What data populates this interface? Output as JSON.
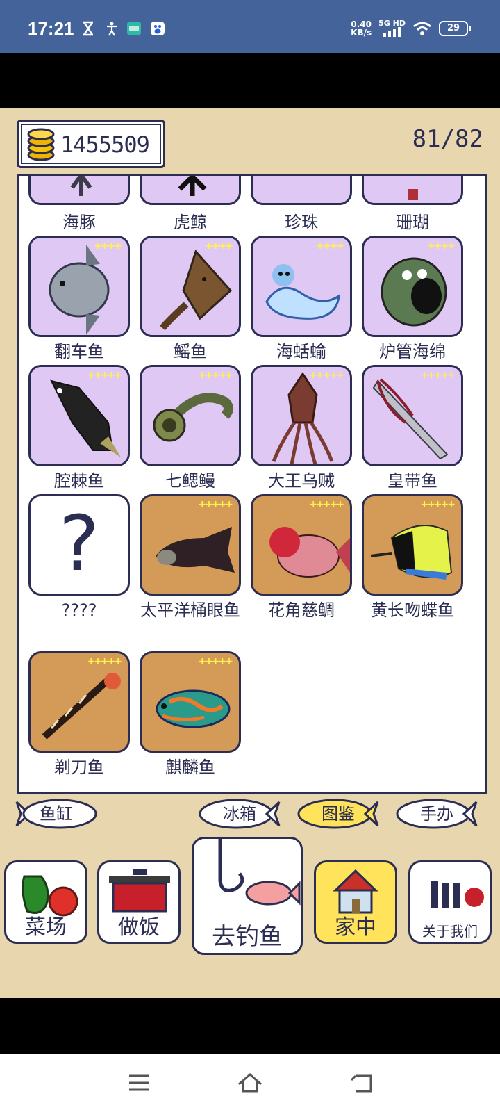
{
  "status_bar": {
    "time": "17:21",
    "net_speed_value": "0.40",
    "net_speed_unit": "KB/s",
    "network_label": "5G HD",
    "battery": "29"
  },
  "header": {
    "coins": "1455509",
    "collection_progress": "81/82"
  },
  "top_row_partial": [
    "海豚",
    "虎鲸",
    "珍珠",
    "珊瑚"
  ],
  "fish_cards": [
    {
      "name": "翻车鱼",
      "stars": "++++",
      "bg": "purple"
    },
    {
      "name": "鳐鱼",
      "stars": "++++",
      "bg": "purple"
    },
    {
      "name": "海蛞蝓",
      "stars": "++++",
      "bg": "purple"
    },
    {
      "name": "炉管海绵",
      "stars": "++++",
      "bg": "purple"
    },
    {
      "name": "腔棘鱼",
      "stars": "+++++",
      "bg": "purple"
    },
    {
      "name": "七鳃鳗",
      "stars": "+++++",
      "bg": "purple"
    },
    {
      "name": "大王乌贼",
      "stars": "+++++",
      "bg": "purple"
    },
    {
      "name": "皇带鱼",
      "stars": "+++++",
      "bg": "purple"
    },
    {
      "name": "????",
      "stars": "",
      "bg": "white",
      "glyph": "?"
    },
    {
      "name": "太平洋桶眼鱼",
      "stars": "+++++",
      "bg": "orange"
    },
    {
      "name": "花角慈鲷",
      "stars": "+++++",
      "bg": "orange"
    },
    {
      "name": "黄长吻蝶鱼",
      "stars": "+++++",
      "bg": "orange"
    },
    {
      "name": "剃刀鱼",
      "stars": "+++++",
      "bg": "orange"
    },
    {
      "name": "麒麟鱼",
      "stars": "+++++",
      "bg": "orange"
    }
  ],
  "tabs": {
    "fish_tank": "鱼缸",
    "fridge": "冰箱",
    "encyclopedia": "图鉴",
    "figures": "手办"
  },
  "bottom_nav": {
    "farm": "菜场",
    "cook": "做饭",
    "fishing": "去钓鱼",
    "home": "家中",
    "about": "关于我们"
  },
  "colors": {
    "status_bar": "#44639a",
    "game_bg": "#e8d7ae",
    "ink": "#2b2d52",
    "card_purple": "#e0c8f5",
    "card_orange": "#d49a58",
    "highlight": "#ffe35a"
  }
}
